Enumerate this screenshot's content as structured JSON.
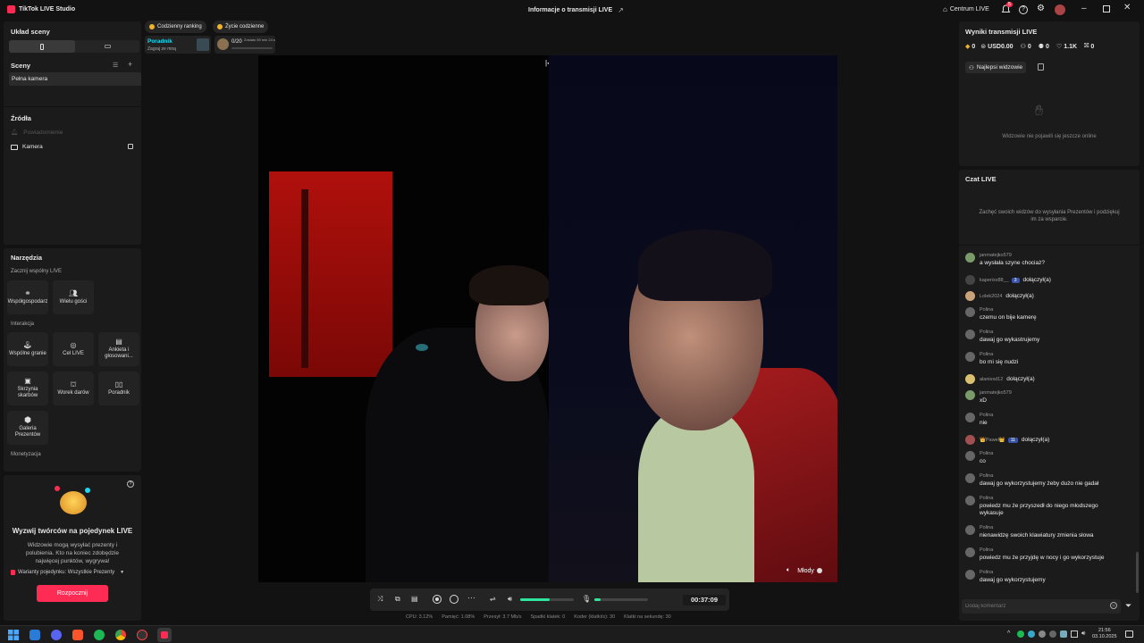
{
  "titlebar": {
    "app_title": "TikTok LIVE Studio",
    "center_title": "Informacje o transmisji LIVE",
    "centrum": "Centrum LIVE",
    "notif_count": "5"
  },
  "left": {
    "scene_layout": "Układ sceny",
    "scenes_title": "Sceny",
    "scene_item": "Pełna kamera",
    "sources_title": "Źródła",
    "source_disabled": "Powiadomienie",
    "source_camera": "Kamera",
    "tools_title": "Narzędzia",
    "start_live_section": "Zacznij wspólny LIVE",
    "cohost": "Współgospodarz",
    "guests": "Wielu gości",
    "interaction_section": "Interakcja",
    "co_play": "Wspólne granie",
    "live_goal": "Cel LIVE",
    "poll": "Ankieta i głosowani...",
    "treasure": "Skrzynia skarbów",
    "gift_bag": "Worek darów",
    "guide": "Poradnik",
    "gift_gallery": "Galeria Prezentów",
    "monetization_section": "Monetyzacja"
  },
  "battle": {
    "title": "Wyzwij twórców na pojedynek LIVE",
    "desc": "Widzowie mogą wysyłać prezenty i polubienia. Kto na koniec zdobędzie najwięcej punktów, wygrywa!",
    "variants": "Warianty pojedynku: Wszystkie Prezenty",
    "start": "Rozpocznij"
  },
  "top_chips": {
    "ranking": "Codzienny ranking",
    "daily_life": "Życie codzienne",
    "guide_title": "Poradnik",
    "guide_sub": "Zagraj ze mną",
    "progress": "0/20",
    "progress_sub": "Zostało 59 min 24 s"
  },
  "video": {
    "guest_name": "Młody"
  },
  "controls": {
    "timer": "00:37:09"
  },
  "stats_bar": {
    "cpu": "CPU: 3.12%",
    "memory": "Pamięć: 1.08%",
    "bandwidth": "Przesył: 3.7 Mb/s",
    "dropped": "Spadki klatek: 0",
    "encoder": "Koder (klatki/s): 30",
    "fps": "Klatki na sekundę: 30"
  },
  "right": {
    "results_title": "Wyniki transmisji LIVE",
    "diamonds": "0",
    "usd": "USD0.00",
    "viewers": "0",
    "followers": "0",
    "likes": "1.1K",
    "gifts": "0",
    "top_viewers_tab": "Najlepsi widzowie",
    "no_viewers": "Widzowie nie pojawili się jeszcze online",
    "chat_title": "Czat LIVE",
    "chat_hint": "Zachęć swoich widzów do wysyłania Prezentów i podziękuj im za wsparcie.",
    "comment_placeholder": "Dodaj komentarz"
  },
  "chat": [
    {
      "name": "janmatejko579",
      "msg": "a wysłała szyne chociaż?",
      "color": "#7a9a6a"
    },
    {
      "name": "kaperixx88__",
      "badge": "3",
      "msg": "dołączył(a)",
      "joined": true,
      "color": "#444"
    },
    {
      "name": "Lolek2024",
      "msg": "dołączył(a)",
      "joined": true,
      "color": "#c9a27a"
    },
    {
      "name": "Polina",
      "msg": "czemu on bije kamerę",
      "color": "#666"
    },
    {
      "name": "Polina",
      "msg": "dawaj go wykastrujemy",
      "color": "#666"
    },
    {
      "name": "Polina",
      "msg": "bo mi się nudzi",
      "color": "#666"
    },
    {
      "name": "alanixxd12",
      "msg": "dołączył(a)",
      "joined": true,
      "color": "#d8c070"
    },
    {
      "name": "janmatejko579",
      "msg": "xD",
      "color": "#7a9a6a"
    },
    {
      "name": "Polina",
      "msg": "nie",
      "color": "#666"
    },
    {
      "name": "👑Paweł👑",
      "badge": "11",
      "msg": "dołączył(a)",
      "joined": true,
      "color": "#a05050"
    },
    {
      "name": "Polina",
      "msg": "co",
      "color": "#666"
    },
    {
      "name": "Polina",
      "msg": "dawaj go wykorzystujemy żeby dużo nie gadał",
      "color": "#666"
    },
    {
      "name": "Polina",
      "msg": "powiedz mu że przyszedł do niego młodszego",
      "msg2": "wykasuje",
      "color": "#666"
    },
    {
      "name": "Polina",
      "msg": "nienawidzę swoich klawiatury zmienia słowa",
      "color": "#666"
    },
    {
      "name": "Polina",
      "msg": "powiedz mu że przyjdę w nocy i go wykorzystuje",
      "color": "#666"
    },
    {
      "name": "Polina",
      "msg": "dawaj go wykorzystujemy",
      "color": "#666"
    }
  ],
  "taskbar": {
    "time": "21:56",
    "date": "03.10.2025"
  },
  "colors": {
    "accent": "#fe2c55",
    "teal": "#20d5ec",
    "green": "#2ee59d"
  }
}
